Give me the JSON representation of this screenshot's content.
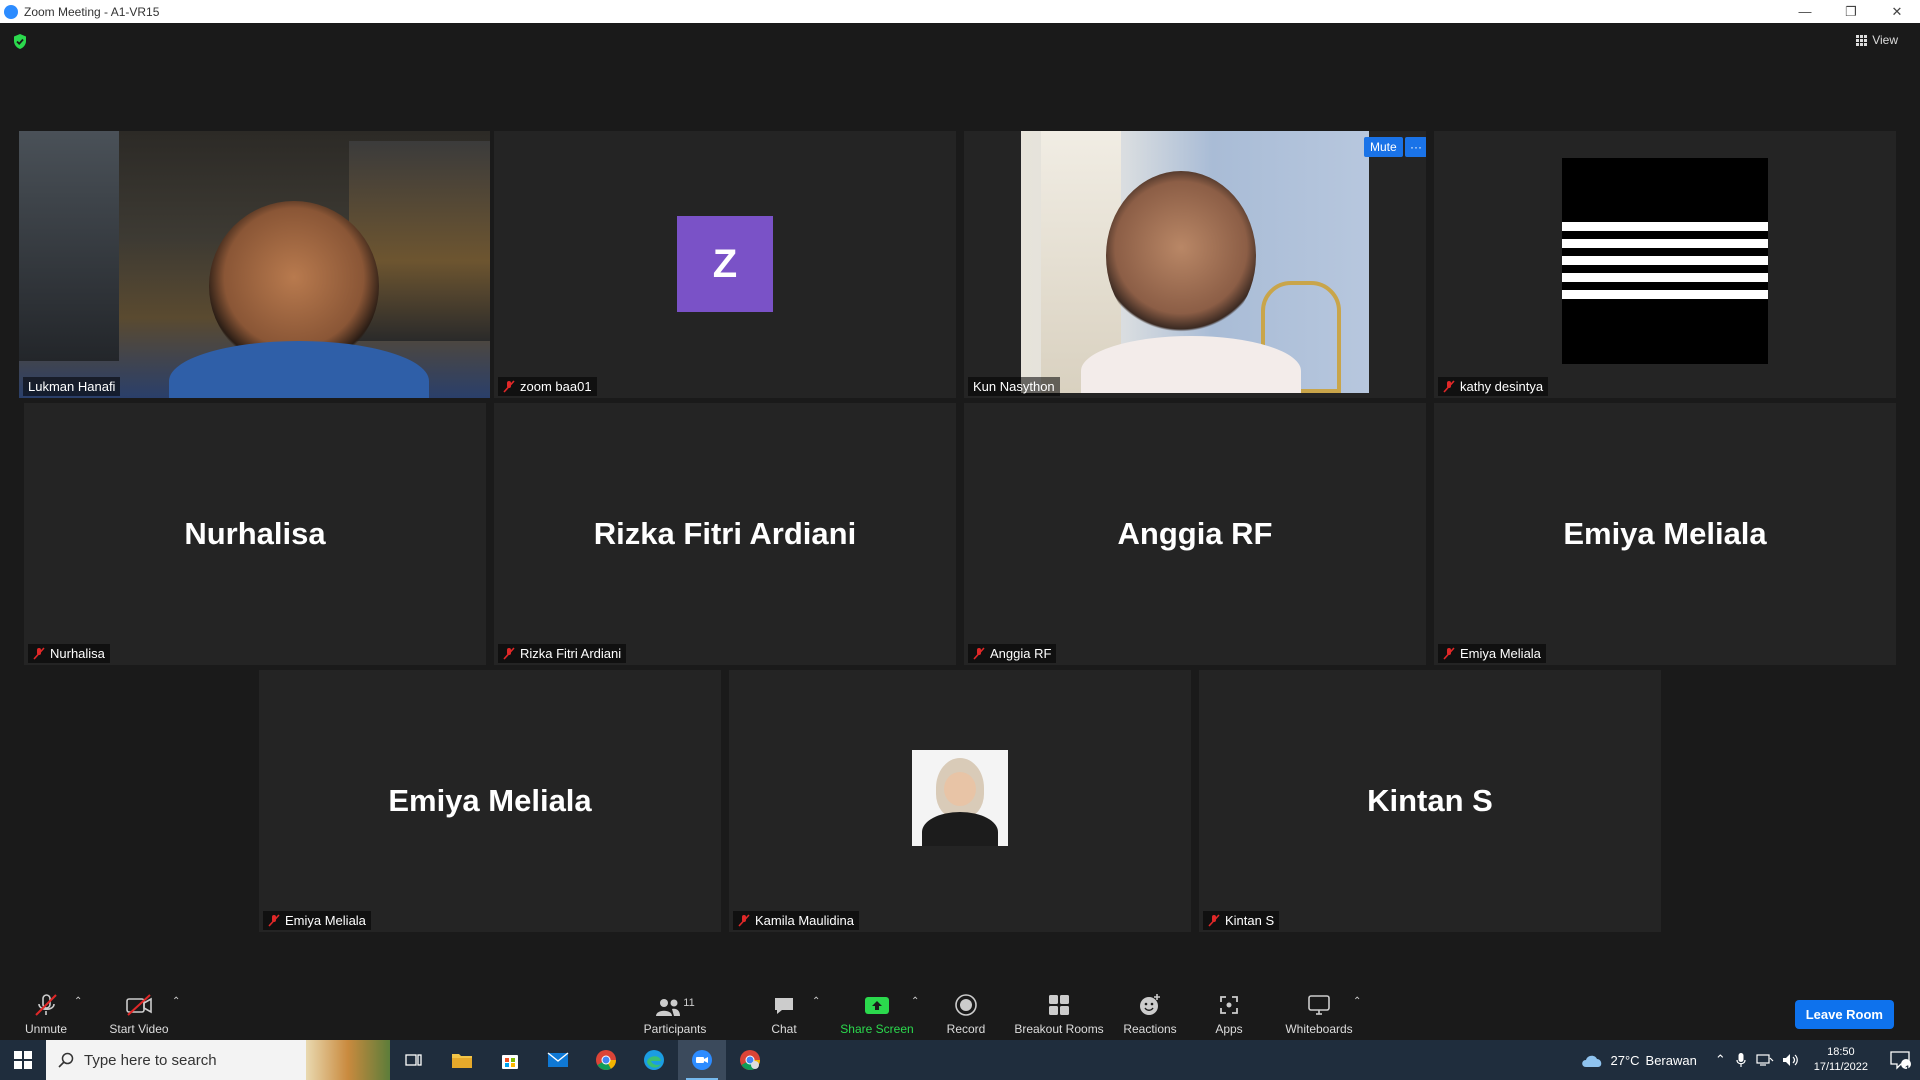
{
  "window": {
    "title": "Zoom Meeting - A1-VR15"
  },
  "header": {
    "view_label": "View"
  },
  "participants": [
    {
      "name": "Lukman Hanafi",
      "kind": "video",
      "muted": false,
      "active_speaker": true
    },
    {
      "name": "zoom baa01",
      "kind": "avatar-letter",
      "letter": "Z",
      "muted": true
    },
    {
      "name": "Kun Nasython",
      "kind": "video",
      "muted": false
    },
    {
      "name": "kathy desintya",
      "kind": "avatar-image",
      "muted": true
    },
    {
      "name": "Nurhalisa",
      "kind": "name-only",
      "display_name": "Nurhalisa",
      "muted": true
    },
    {
      "name": "Rizka Fitri Ardiani",
      "kind": "name-only",
      "display_name": "Rizka Fitri Ardiani",
      "muted": true
    },
    {
      "name": "Anggia RF",
      "kind": "name-only",
      "display_name": "Anggia RF",
      "muted": true
    },
    {
      "name": "Emiya Meliala",
      "kind": "name-only",
      "display_name": "Emiya Meliala",
      "muted": true
    },
    {
      "name": "Emiya Meliala",
      "kind": "name-only",
      "display_name": "Emiya Meliala",
      "muted": true
    },
    {
      "name": "Kamila Maulidina",
      "kind": "avatar-image",
      "muted": true
    },
    {
      "name": "Kintan S",
      "kind": "name-only",
      "display_name": "Kintan S",
      "muted": true
    }
  ],
  "hover_controls": {
    "mute_label": "Mute",
    "more_label": "···"
  },
  "toolbar": {
    "unmute": "Unmute",
    "start_video": "Start Video",
    "participants": "Participants",
    "participants_count": "11",
    "chat": "Chat",
    "share_screen": "Share Screen",
    "record": "Record",
    "breakout_rooms": "Breakout Rooms",
    "reactions": "Reactions",
    "apps": "Apps",
    "whiteboards": "Whiteboards",
    "leave_room": "Leave Room"
  },
  "taskbar": {
    "search_placeholder": "Type here to search",
    "weather_temp": "27°C",
    "weather_desc": "Berawan",
    "time": "18:50",
    "date": "17/11/2022",
    "notification_count": "1"
  },
  "colors": {
    "active_speaker_border": "#c6e04a",
    "avatar_z": "#7a52c7",
    "share_green": "#2bd94d",
    "leave_blue": "#0e72ed"
  }
}
